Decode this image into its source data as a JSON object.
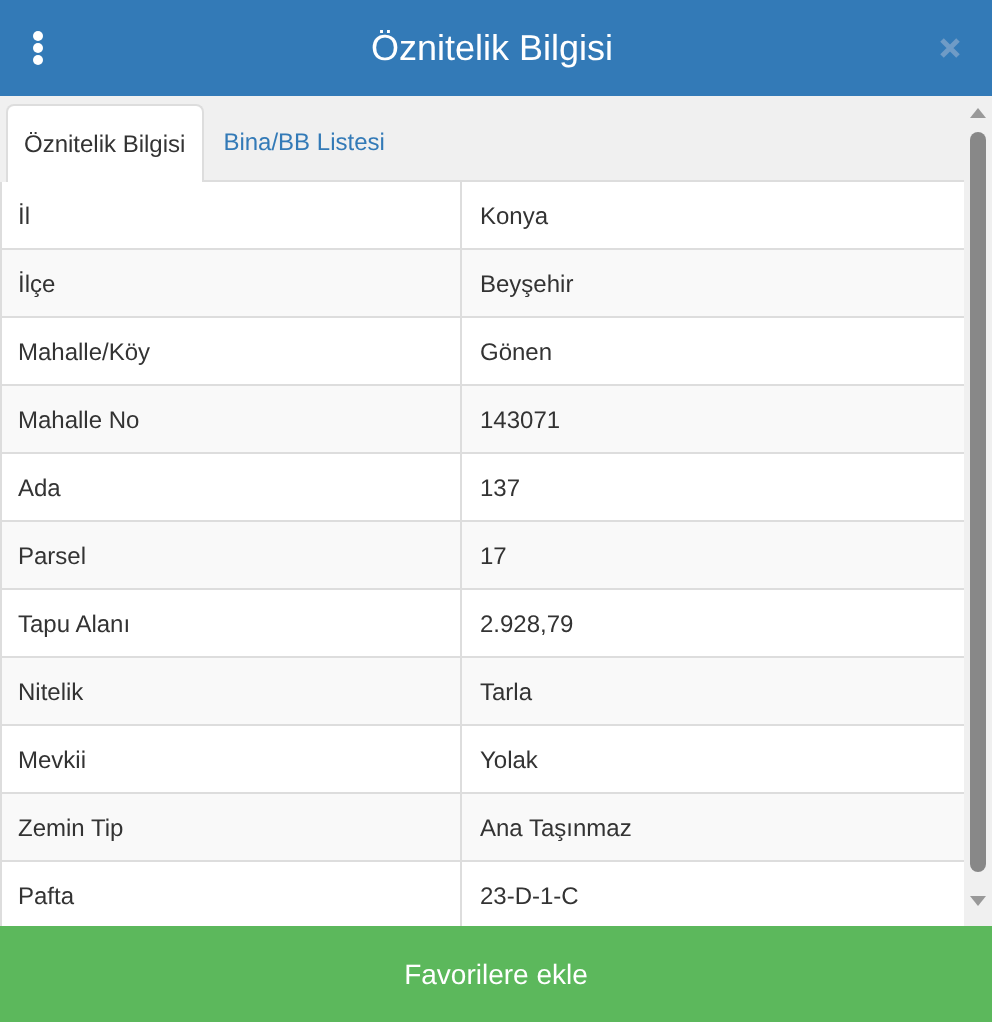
{
  "header": {
    "title": "Öznitelik Bilgisi"
  },
  "tabs": [
    {
      "label": "Öznitelik Bilgisi",
      "selected": true
    },
    {
      "label": "Bina/BB Listesi",
      "selected": false
    }
  ],
  "table": {
    "rows": [
      {
        "name": "İl",
        "value": "Konya"
      },
      {
        "name": "İlçe",
        "value": "Beyşehir"
      },
      {
        "name": "Mahalle/Köy",
        "value": "Gönen"
      },
      {
        "name": "Mahalle No",
        "value": "143071"
      },
      {
        "name": "Ada",
        "value": "137"
      },
      {
        "name": "Parsel",
        "value": "17"
      },
      {
        "name": "Tapu Alanı",
        "value": "2.928,79"
      },
      {
        "name": "Nitelik",
        "value": "Tarla"
      },
      {
        "name": "Mevkii",
        "value": "Yolak"
      },
      {
        "name": "Zemin Tip",
        "value": "Ana Taşınmaz"
      },
      {
        "name": "Pafta",
        "value": "23-D-1-C"
      }
    ]
  },
  "footer": {
    "button": "Favorilere ekle"
  }
}
